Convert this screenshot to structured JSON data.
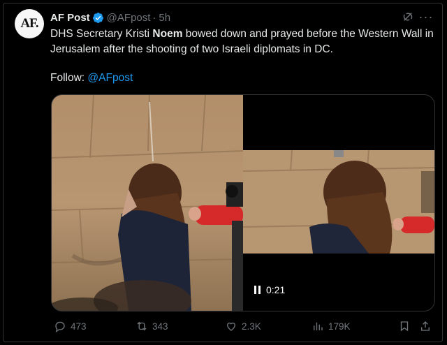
{
  "author": {
    "avatar_text": "AF.",
    "name": "AF Post",
    "handle": "@AFpost",
    "separator": "·",
    "time": "5h"
  },
  "tweet": {
    "text_before": "DHS Secretary Kristi ",
    "text_bold": "Noem",
    "text_after": " bowed down and prayed before the Western Wall in Jerusalem after the shooting of two Israeli diplomats in DC.",
    "follow_label": "Follow: ",
    "follow_link": "@AFpost"
  },
  "video": {
    "timestamp": "0:21"
  },
  "actions": {
    "replies": "473",
    "reposts": "343",
    "likes": "2.3K",
    "views": "179K"
  },
  "colors": {
    "accent": "#1d9bf0",
    "muted": "#71767b",
    "background": "#000000"
  },
  "icons": [
    "verified-badge-icon",
    "grok-icon",
    "more-icon",
    "pause-icon",
    "reply-icon",
    "repost-icon",
    "like-icon",
    "views-icon",
    "bookmark-icon",
    "share-icon"
  ]
}
